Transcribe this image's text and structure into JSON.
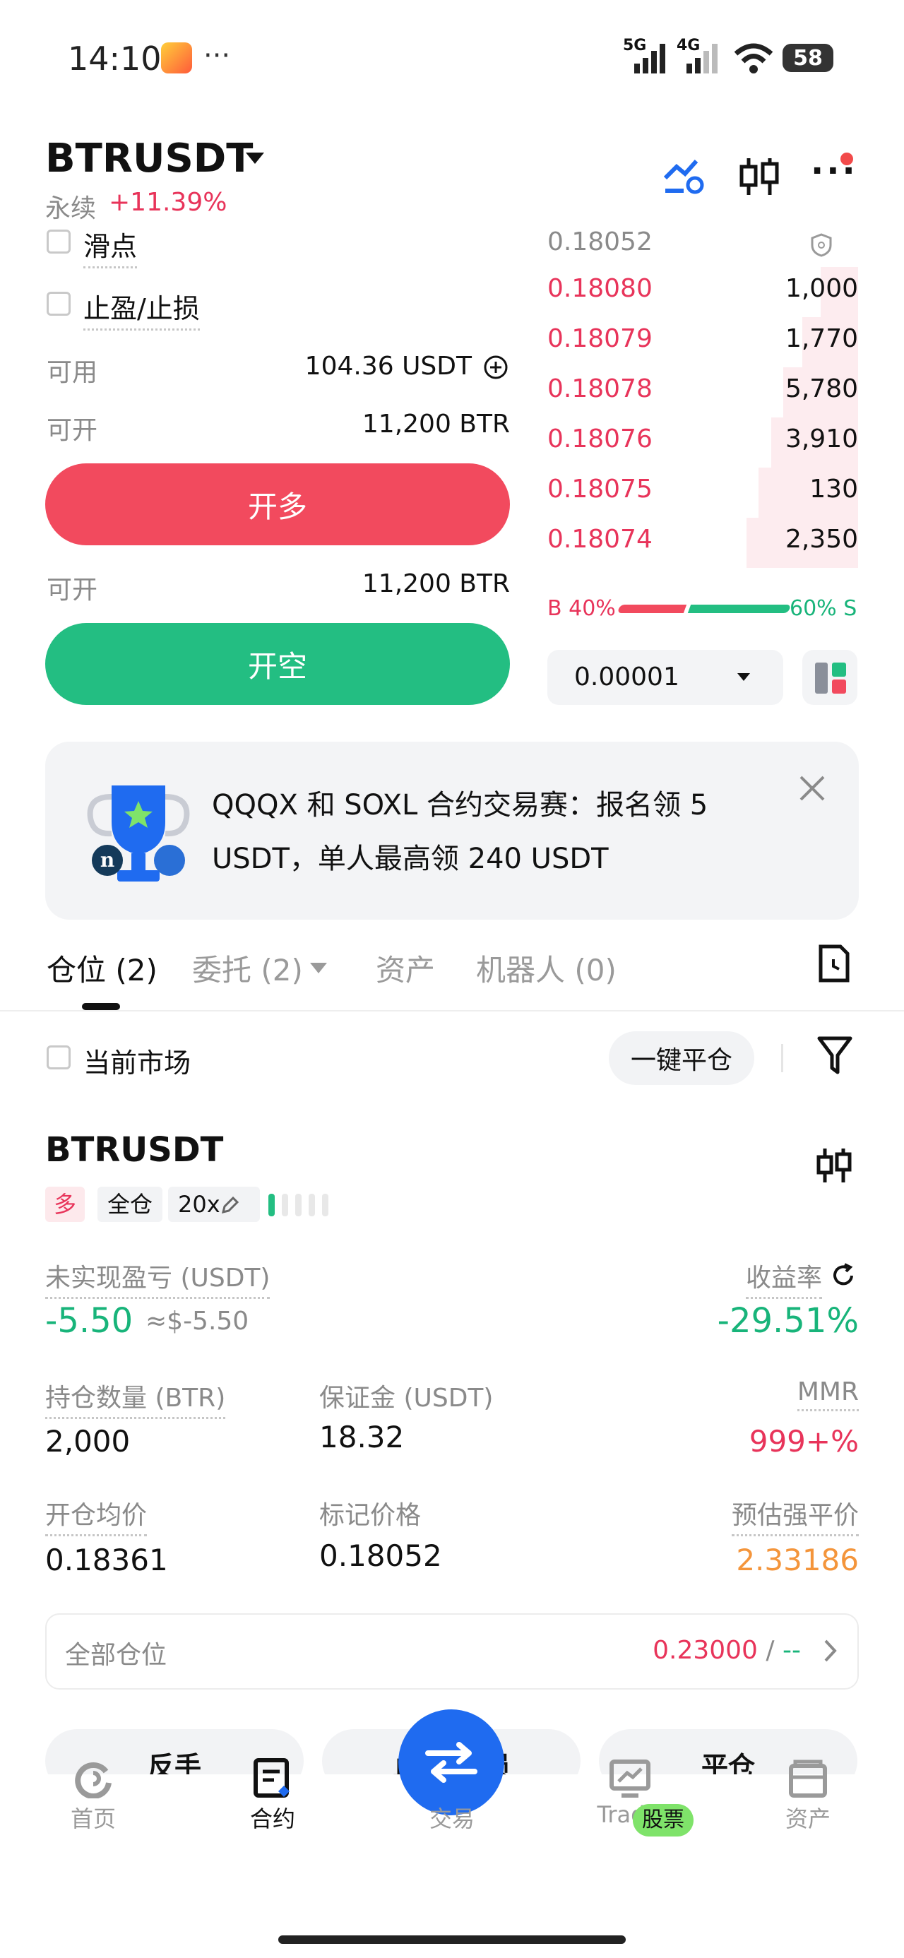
{
  "status_bar": {
    "time": "14:10",
    "dots": "···",
    "net1": "5G",
    "net2": "4G",
    "battery": "58"
  },
  "header": {
    "symbol": "BTRUSDT",
    "perp": "永续",
    "change": "+11.39%"
  },
  "form": {
    "slippage_label": "滑点",
    "tpsl_label": "止盈/止损",
    "available_label": "可用",
    "available_value": "104.36 USDT",
    "open_label": "可开",
    "open_value": "11,200 BTR",
    "long_button": "开多",
    "open_label2": "可开",
    "open_value2": "11,200 BTR",
    "short_button": "开空"
  },
  "orderbook": {
    "mark_price": "0.18052",
    "asks": [
      {
        "price": "0.18080",
        "qty": "1,000",
        "depth": 0.12
      },
      {
        "price": "0.18079",
        "qty": "1,770",
        "depth": 0.18
      },
      {
        "price": "0.18078",
        "qty": "5,780",
        "depth": 0.24
      },
      {
        "price": "0.18076",
        "qty": "3,910",
        "depth": 0.28
      },
      {
        "price": "0.18075",
        "qty": "130",
        "depth": 0.32
      },
      {
        "price": "0.18074",
        "qty": "2,350",
        "depth": 0.36
      }
    ],
    "buy_ratio": "B 40%",
    "sell_ratio": "60% S",
    "buy_ratio_value": 40,
    "tick_size": "0.00001"
  },
  "banner": {
    "text": "QQQX 和 SOXL 合约交易赛：报名领 5 USDT，单人最高领 240 USDT"
  },
  "tabs": [
    {
      "label": "仓位 (2)"
    },
    {
      "label": "委托 (2)"
    },
    {
      "label": "资产"
    },
    {
      "label": "机器人 (0)"
    }
  ],
  "filter": {
    "current_market": "当前市场",
    "close_all": "一键平仓"
  },
  "position": {
    "symbol": "BTRUSDT",
    "side": "多",
    "margin_mode": "全仓",
    "leverage": "20x",
    "upnl_label": "未实现盈亏 (USDT)",
    "upnl_value": "-5.50",
    "upnl_usd": "≈$-5.50",
    "roe_label": "收益率",
    "roe_value": "-29.51%",
    "size_label": "持仓数量 (BTR)",
    "size_value": "2,000",
    "margin_label": "保证金 (USDT)",
    "margin_value": "18.32",
    "mmr_label": "MMR",
    "mmr_value": "999+%",
    "entry_label": "开仓均价",
    "entry_value": "0.18361",
    "mark_label": "标记价格",
    "mark_value": "0.18052",
    "liq_label": "预估强平价",
    "liq_value": "2.33186",
    "all_positions_label": "全部仓位",
    "all_positions_value": "0.23000",
    "all_positions_sep": "/",
    "all_positions_dash": "--",
    "reverse": "反手",
    "tpsl": "止盈/止损",
    "close": "平仓"
  },
  "bottom_nav": {
    "home": "首页",
    "futures": "合约",
    "trade": "交易",
    "tradfi": "TradFi",
    "tradfi_badge": "股票",
    "assets": "资产"
  },
  "colors": {
    "red": "#f24a5e",
    "green": "#23be82",
    "blue": "#1f6bf0"
  }
}
